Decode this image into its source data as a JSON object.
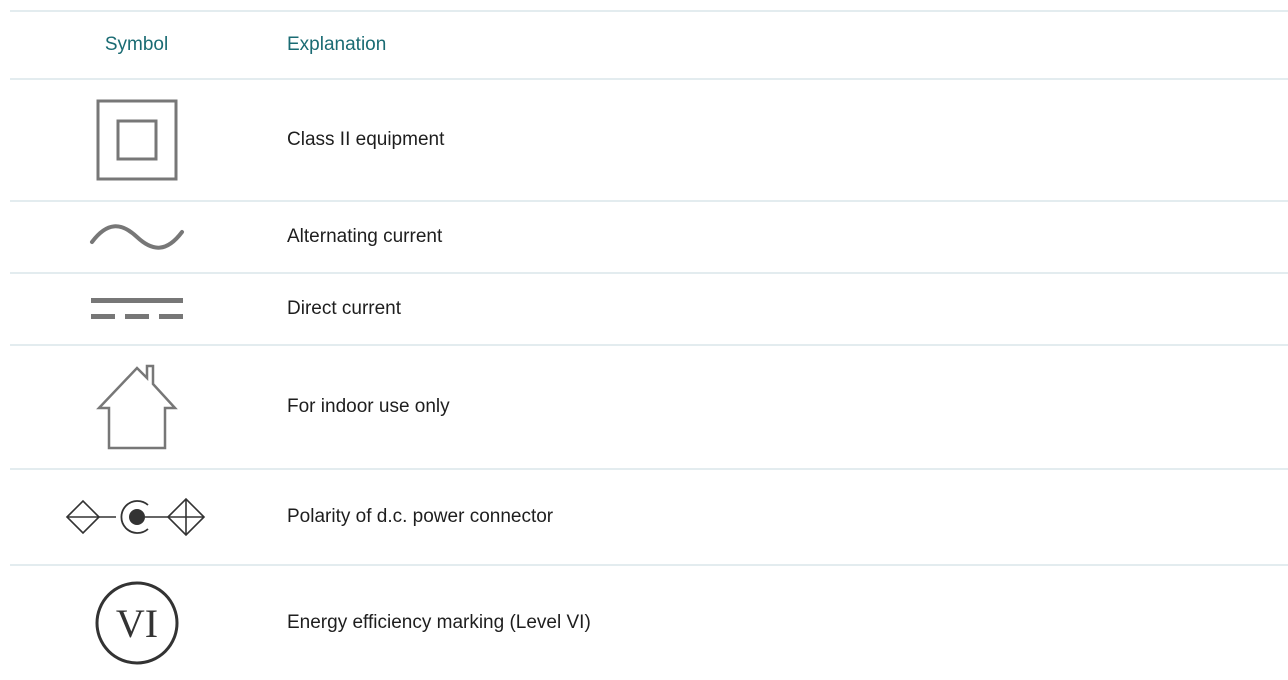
{
  "header": {
    "symbol_label": "Symbol",
    "explanation_label": "Explanation",
    "color": "#1a6b73"
  },
  "rows": [
    {
      "icon": "class-ii-equipment-icon",
      "text": "Class II equipment"
    },
    {
      "icon": "alternating-current-icon",
      "text": "Alternating current"
    },
    {
      "icon": "direct-current-icon",
      "text": "Direct current"
    },
    {
      "icon": "indoor-use-house-icon",
      "text": "For indoor use only"
    },
    {
      "icon": "dc-polarity-icon",
      "text": "Polarity of d.c. power connector"
    },
    {
      "icon": "energy-efficiency-vi-icon",
      "text": "Energy efficiency marking (Level VI)",
      "symbol_text": "VI"
    }
  ],
  "colors": {
    "divider": "#e3ecef",
    "icon_gray": "#777777",
    "icon_dark": "#333333"
  }
}
